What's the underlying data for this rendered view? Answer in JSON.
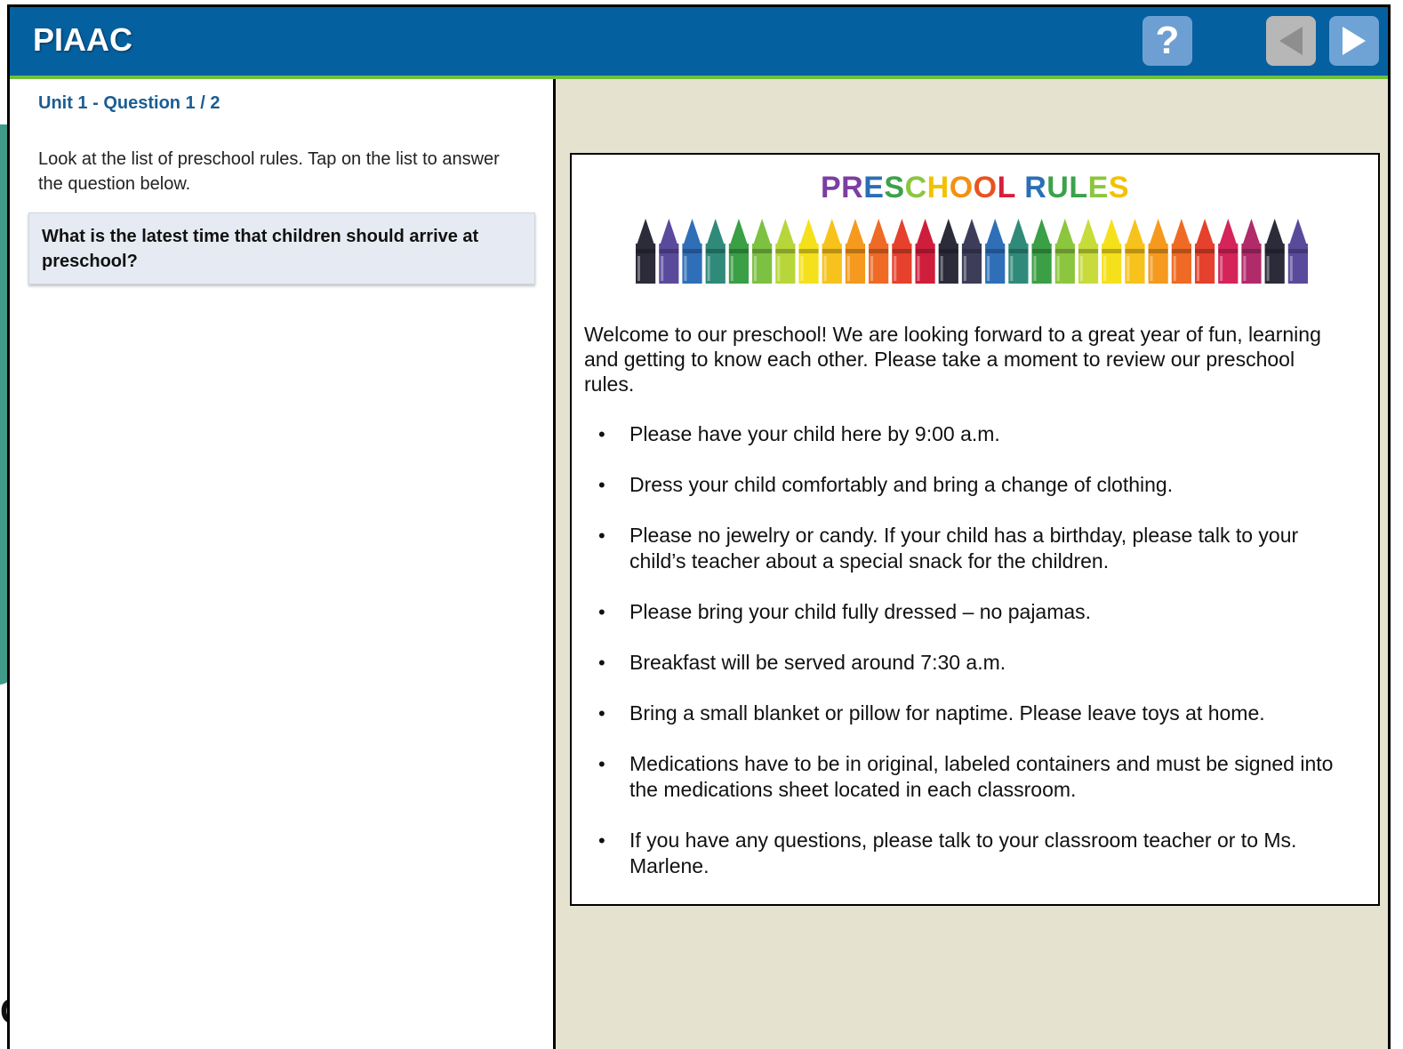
{
  "app": {
    "title": "PIAAC"
  },
  "header": {
    "help_label": "?",
    "icons": {
      "help": "help-icon",
      "prev": "left-arrow-icon",
      "next": "right-arrow-icon"
    }
  },
  "left_panel": {
    "question_number": "Unit 1 - Question 1 / 2",
    "instructions": "Look at the list of preschool rules. Tap on the list to answer the question below.",
    "question": "What is the latest time that children should arrive at preschool?"
  },
  "document": {
    "title_letters": [
      {
        "ch": "P",
        "color": "#7b3fa0"
      },
      {
        "ch": "R",
        "color": "#7b3fa0"
      },
      {
        "ch": "E",
        "color": "#2a6fb5"
      },
      {
        "ch": "S",
        "color": "#3aa24b"
      },
      {
        "ch": "C",
        "color": "#8cc63f"
      },
      {
        "ch": "H",
        "color": "#f2c200"
      },
      {
        "ch": "O",
        "color": "#f29111"
      },
      {
        "ch": "O",
        "color": "#e8531f"
      },
      {
        "ch": "L",
        "color": "#d81e3c"
      },
      {
        "ch": " ",
        "color": "#000000"
      },
      {
        "ch": "R",
        "color": "#2a6fb5"
      },
      {
        "ch": "U",
        "color": "#3aa24b"
      },
      {
        "ch": "L",
        "color": "#3aa24b"
      },
      {
        "ch": "E",
        "color": "#8cc63f"
      },
      {
        "ch": "S",
        "color": "#f2c200"
      }
    ],
    "welcome": "Welcome to our preschool! We are looking forward to a great year of fun, learning and getting to know each other. Please take a moment to review our preschool rules.",
    "rules": [
      "Please have your child here by 9:00 a.m.",
      "Dress your child comfortably and bring a change of clothing.",
      "Please no jewelry or candy. If your child has a birthday, please talk to your child’s teacher about a special snack for the children.",
      "Please bring your child fully dressed – no pajamas.",
      "Breakfast will be served around 7:30 a.m.",
      "Bring a small blanket or pillow for naptime. Please leave toys at home.",
      "Medications have to be in original, labeled containers and must be signed into the medications sheet located in each classroom.",
      "If you have any questions, please talk to your classroom teacher or to Ms. Marlene."
    ],
    "crayon_colors": [
      "#2b2b3a",
      "#5a4a9c",
      "#2f6fb8",
      "#2f8a7a",
      "#3a9f45",
      "#7cc142",
      "#b7d63a",
      "#f5e11b",
      "#f7c21c",
      "#f59a1e",
      "#ef6a24",
      "#e5412c",
      "#cf1e3b",
      "#2b2b3a",
      "#3d3d5a",
      "#2f6fb8",
      "#2f8a7a",
      "#3a9f45",
      "#8cc63f",
      "#c7dc3a",
      "#f5e11b",
      "#f7c21c",
      "#f59a1e",
      "#ef6a24",
      "#e5412c",
      "#d4245a",
      "#b12a6a",
      "#2b2b3a",
      "#5a4a9c"
    ]
  },
  "background": {
    "edge_letter": "C"
  }
}
